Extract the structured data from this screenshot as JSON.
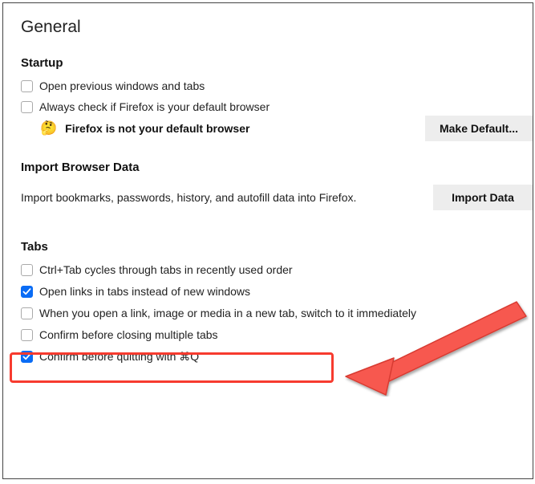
{
  "page": {
    "title": "General"
  },
  "startup": {
    "heading": "Startup",
    "opt_open_prev": {
      "label": "Open previous windows and tabs",
      "checked": false
    },
    "opt_check_default": {
      "label": "Always check if Firefox is your default browser",
      "checked": false
    },
    "default_status": {
      "text": "Firefox is not your default browser",
      "emoji": "🤔"
    },
    "make_default_btn": "Make Default..."
  },
  "import": {
    "heading": "Import Browser Data",
    "desc": "Import bookmarks, passwords, history, and autofill data into Firefox.",
    "btn": "Import Data"
  },
  "tabs": {
    "heading": "Tabs",
    "opt_ctrltab": {
      "label": "Ctrl+Tab cycles through tabs in recently used order",
      "checked": false
    },
    "opt_links_in_tabs": {
      "label": "Open links in tabs instead of new windows",
      "checked": true
    },
    "opt_switch": {
      "label": "When you open a link, image or media in a new tab, switch to it immediately",
      "checked": false
    },
    "opt_confirm_close": {
      "label": "Confirm before closing multiple tabs",
      "checked": false
    },
    "opt_confirm_quit": {
      "label": "Confirm before quitting with ⌘Q",
      "checked": true
    }
  }
}
